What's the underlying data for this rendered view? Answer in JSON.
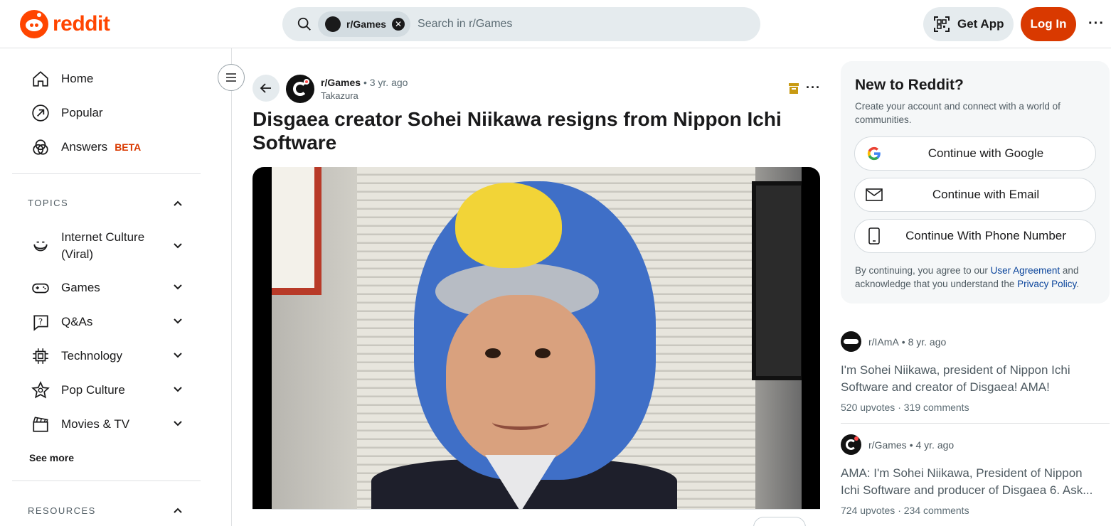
{
  "header": {
    "logo_text": "reddit",
    "search_chip": "r/Games",
    "search_placeholder": "Search in r/Games",
    "get_app": "Get App",
    "login": "Log In",
    "brand_color": "#ff4500",
    "login_color": "#d93900"
  },
  "sidebar": {
    "nav": [
      {
        "label": "Home",
        "icon": "home-icon"
      },
      {
        "label": "Popular",
        "icon": "popular-icon"
      },
      {
        "label": "Answers",
        "badge": "BETA",
        "icon": "answers-icon"
      }
    ],
    "topics_header": "TOPICS",
    "topics": [
      {
        "label": "Internet Culture (Viral)",
        "icon": "smile-icon"
      },
      {
        "label": "Games",
        "icon": "gamepad-icon"
      },
      {
        "label": "Q&As",
        "icon": "question-icon"
      },
      {
        "label": "Technology",
        "icon": "chip-icon"
      },
      {
        "label": "Pop Culture",
        "icon": "star-icon"
      },
      {
        "label": "Movies & TV",
        "icon": "clapper-icon"
      }
    ],
    "see_more": "See more",
    "resources_header": "RESOURCES"
  },
  "post": {
    "subreddit": "r/Games",
    "time": "• 3 yr. ago",
    "author": "Takazura",
    "title": "Disgaea creator Sohei Niikawa resigns from Nippon Ichi Software"
  },
  "signup": {
    "title": "New to Reddit?",
    "subtitle": "Create your account and connect with a world of communities.",
    "google": "Continue with Google",
    "email": "Continue with Email",
    "phone": "Continue With Phone Number",
    "legal_pre": "By continuing, you agree to our ",
    "legal_link1": "User Agreement",
    "legal_mid": " and acknowledge that you understand the ",
    "legal_link2": "Privacy Policy",
    "legal_post": "."
  },
  "related": [
    {
      "subreddit": "r/IAmA",
      "time": "• 8 yr. ago",
      "title": "I'm Sohei Niikawa, president of Nippon Ichi Software and creator of Disgaea! AMA!",
      "upvotes": "520 upvotes",
      "comments": "319 comments"
    },
    {
      "subreddit": "r/Games",
      "time": "• 4 yr. ago",
      "title": "AMA: I'm Sohei Niikawa, President of Nippon Ichi Software and producer of Disgaea 6. Ask...",
      "upvotes": "724 upvotes",
      "comments": "234 comments"
    }
  ]
}
